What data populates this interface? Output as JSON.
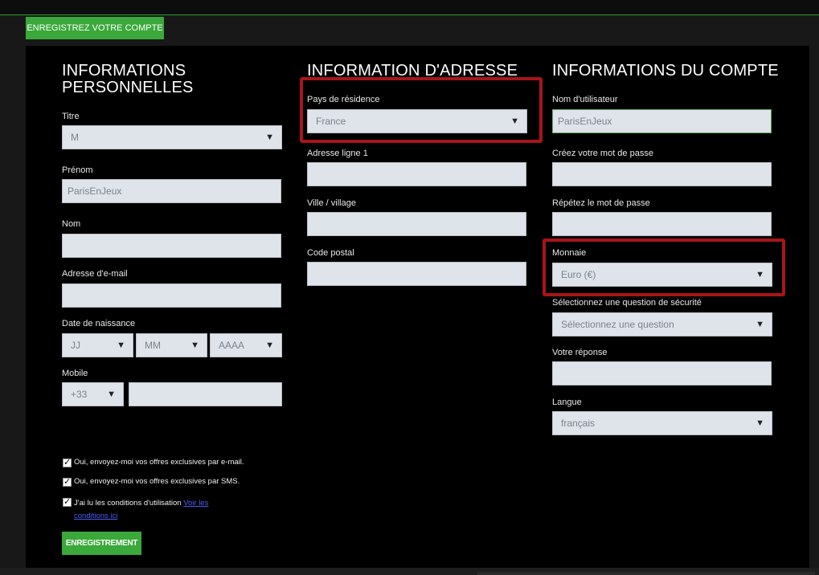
{
  "header": {
    "register_tab": "ENREGISTREZ VOTRE COMPTE"
  },
  "personal": {
    "heading_line1": "INFORMATIONS",
    "heading_line2": "PERSONNELLES",
    "title_label": "Titre",
    "title_value": "M",
    "firstname_label": "Prénom",
    "firstname_value": "ParisEnJeux",
    "lastname_label": "Nom",
    "lastname_value": "",
    "email_label": "Adresse d'e-mail",
    "email_value": "",
    "dob_label": "Date de naissance",
    "dob_day": "JJ",
    "dob_month": "MM",
    "dob_year": "AAAA",
    "mobile_label": "Mobile",
    "mobile_prefix": "+33",
    "mobile_value": ""
  },
  "address": {
    "heading": "INFORMATION D'ADRESSE",
    "country_label": "Pays de résidence",
    "country_value": "France",
    "line1_label": "Adresse ligne 1",
    "line1_value": "",
    "city_label": "Ville / village",
    "city_value": "",
    "postal_label": "Code postal",
    "postal_value": ""
  },
  "account": {
    "heading": "INFORMATIONS DU COMPTE",
    "username_label": "Nom d'utilisateur",
    "username_value": "ParisEnJeux",
    "password_label": "Créez votre mot de passe",
    "password_value": "",
    "repeat_label": "Répétez le mot de passe",
    "repeat_value": "",
    "currency_label": "Monnaie",
    "currency_value": "Euro (€)",
    "question_label": "Sélectionnez une question de sécurité",
    "question_value": "Sélectionnez une question",
    "answer_label": "Votre réponse",
    "answer_value": "",
    "language_label": "Langue",
    "language_value": "français"
  },
  "consents": {
    "email_offers": "Oui, envoyez-moi vos offres exclusives par e-mail.",
    "sms_offers": "Oui, envoyez-moi vos offres exclusives par SMS.",
    "terms_text": "J'ai lu les conditions d'utilisation ",
    "terms_link": "Voir les conditions ici",
    "check_mark": "✓"
  },
  "submit": {
    "label": "ENREGISTREMENT"
  },
  "icons": {
    "dropdown_arrow": "▼"
  },
  "colors": {
    "accent_green": "#3aa83a",
    "highlight_red": "#a8151a",
    "field_bg": "#dfe3ea"
  }
}
